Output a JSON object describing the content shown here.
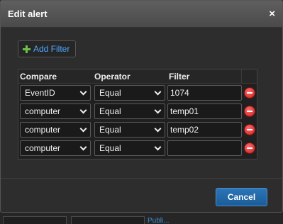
{
  "dialog": {
    "title": "Edit alert",
    "close_label": "×",
    "add_filter_label": "Add Filter",
    "cancel_label": "Cancel"
  },
  "table": {
    "headers": {
      "compare": "Compare",
      "operator": "Operator",
      "filter": "Filter"
    },
    "rows": [
      {
        "compare": "EventID",
        "operator": "Equal",
        "filter": "1074"
      },
      {
        "compare": "computer",
        "operator": "Equal",
        "filter": "temp01"
      },
      {
        "compare": "computer",
        "operator": "Equal",
        "filter": "temp02"
      },
      {
        "compare": "computer",
        "operator": "Equal",
        "filter": ""
      }
    ]
  },
  "background": {
    "link_text": "Publi..."
  },
  "colors": {
    "accent": "#4fa8ff",
    "cancel_bg": "#2a72b3",
    "remove": "#e02a2a",
    "add": "#6cc04a"
  }
}
